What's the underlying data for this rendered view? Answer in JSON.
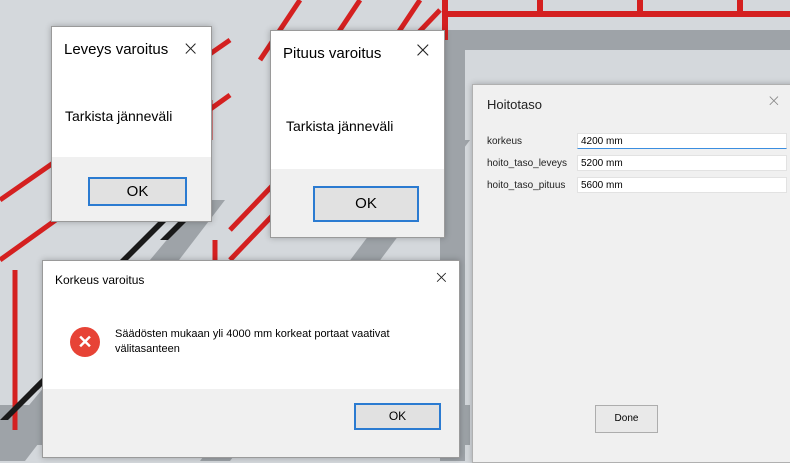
{
  "dialogs": {
    "leveys": {
      "title": "Leveys varoitus",
      "message": "Tarkista jänneväli",
      "ok": "OK"
    },
    "pituus": {
      "title": "Pituus varoitus",
      "message": "Tarkista jänneväli",
      "ok": "OK"
    },
    "korkeus": {
      "title": "Korkeus varoitus",
      "message": "Säädösten mukaan yli 4000 mm korkeat portaat vaativat välitasanteen",
      "ok": "OK"
    }
  },
  "hoitotaso": {
    "title": "Hoitotaso",
    "fields": [
      {
        "label": "korkeus",
        "value": "4200 mm"
      },
      {
        "label": "hoito_taso_leveys",
        "value": "5200 mm"
      },
      {
        "label": "hoito_taso_pituus",
        "value": "5600 mm"
      }
    ],
    "done": "Done"
  },
  "icons": {
    "close": "×",
    "error": "✕"
  },
  "colors": {
    "accent": "#2b7bd1",
    "error": "#e74336",
    "railing": "#d42020"
  }
}
